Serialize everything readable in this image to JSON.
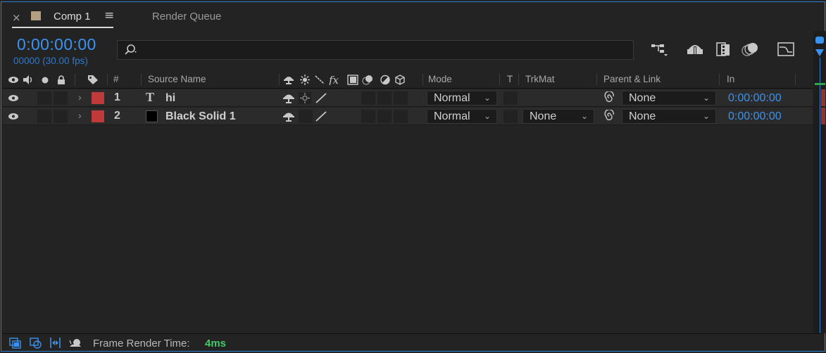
{
  "tabs": [
    {
      "label": "Comp 1",
      "swatch_color": "#b59f82",
      "active": true
    },
    {
      "label": "Render Queue",
      "active": false
    }
  ],
  "tab_close_glyph": "×",
  "tab_menu_glyph": "≡",
  "timecode": "0:00:00:00",
  "frame_info": "00000 (30.00 fps)",
  "search": {
    "placeholder": "",
    "value": ""
  },
  "toolbar_icons": [
    "composition-flowchart-icon",
    "draft-3d-icon",
    "frame-blending-icon",
    "motion-blur-icon",
    "graph-editor-icon"
  ],
  "columns": {
    "number": "#",
    "source_name": "Source Name",
    "mode": "Mode",
    "track_matte_t": "T",
    "trkmat": "TrkMat",
    "parent_link": "Parent & Link",
    "in": "In"
  },
  "layers": [
    {
      "number": "1",
      "type_glyph": "T",
      "name": "hi",
      "label_color": "#bf3b3b",
      "mode": "Normal",
      "trkmat": "",
      "parent": "None",
      "in": "0:00:00:00",
      "kind": "text"
    },
    {
      "number": "2",
      "type_glyph": "",
      "name": "Black Solid 1",
      "label_color": "#bf3b3b",
      "mode": "Normal",
      "trkmat": "None",
      "parent": "None",
      "in": "0:00:00:00",
      "kind": "solid"
    }
  ],
  "status": {
    "label": "Frame Render Time:",
    "value": "4ms",
    "value_color": "#45c86a"
  },
  "accent_color": "#3a93f0"
}
